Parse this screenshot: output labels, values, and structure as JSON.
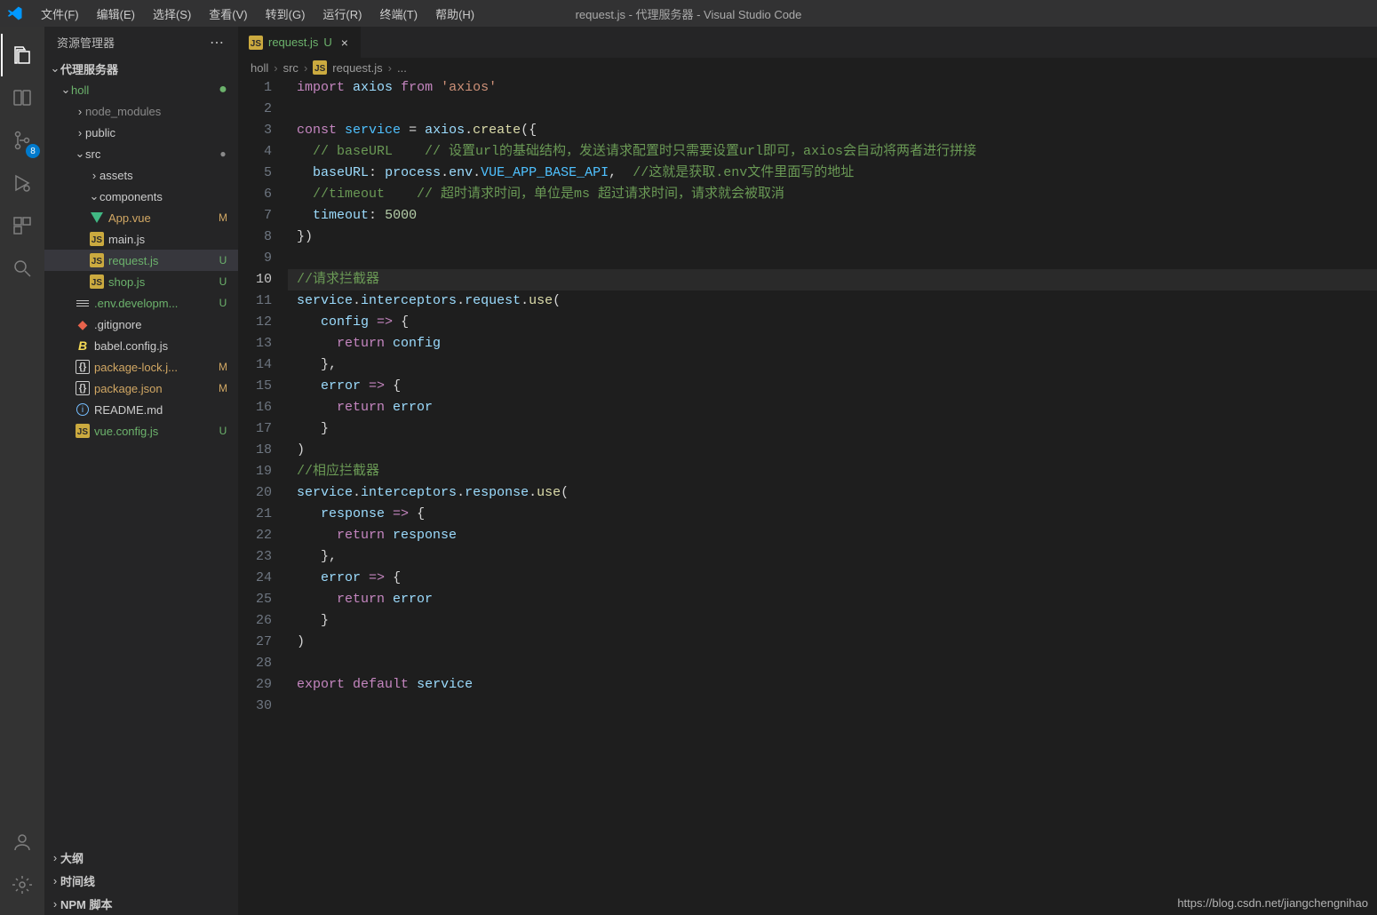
{
  "menu": [
    "文件(F)",
    "编辑(E)",
    "选择(S)",
    "查看(V)",
    "转到(G)",
    "运行(R)",
    "终端(T)",
    "帮助(H)"
  ],
  "window_title": "request.js - 代理服务器 - Visual Studio Code",
  "sidebar_title": "资源管理器",
  "scm_badge": "8",
  "project": {
    "name": "代理服务器",
    "root": "holl",
    "folders": {
      "node_modules": "node_modules",
      "public": "public",
      "src": "src",
      "assets": "assets",
      "components": "components"
    },
    "files": {
      "app_vue": {
        "label": "App.vue",
        "status": "M"
      },
      "main_js": {
        "label": "main.js",
        "status": ""
      },
      "request_js": {
        "label": "request.js",
        "status": "U"
      },
      "shop_js": {
        "label": "shop.js",
        "status": "U"
      },
      "env_dev": {
        "label": ".env.developm...",
        "status": "U"
      },
      "gitignore": {
        "label": ".gitignore",
        "status": ""
      },
      "babel": {
        "label": "babel.config.js",
        "status": ""
      },
      "pkg_lock": {
        "label": "package-lock.j...",
        "status": "M"
      },
      "pkg": {
        "label": "package.json",
        "status": "M"
      },
      "readme": {
        "label": "README.md",
        "status": ""
      },
      "vue_cfg": {
        "label": "vue.config.js",
        "status": "U"
      }
    }
  },
  "panels": {
    "outline": "大纲",
    "timeline": "时间线",
    "npm": "NPM 脚本"
  },
  "tab": {
    "name": "request.js",
    "status": "U"
  },
  "breadcrumb": {
    "p0": "holl",
    "p1": "src",
    "p2": "request.js",
    "p3": "..."
  },
  "code_tokens": [
    [
      [
        "kw",
        "import"
      ],
      [
        "punc",
        " "
      ],
      [
        "ident",
        "axios"
      ],
      [
        "punc",
        " "
      ],
      [
        "kw",
        "from"
      ],
      [
        "punc",
        " "
      ],
      [
        "str",
        "'axios'"
      ]
    ],
    [],
    [
      [
        "kw",
        "const"
      ],
      [
        "punc",
        " "
      ],
      [
        "const",
        "service"
      ],
      [
        "punc",
        " "
      ],
      [
        "punc",
        "="
      ],
      [
        "punc",
        " "
      ],
      [
        "ident",
        "axios"
      ],
      [
        "punc",
        "."
      ],
      [
        "fn",
        "create"
      ],
      [
        "punc",
        "("
      ],
      [
        "punc",
        "{"
      ]
    ],
    [
      [
        "punc",
        "  "
      ],
      [
        "com",
        "// baseURL    // 设置url的基础结构，发送请求配置时只需要设置url即可，axios会自动将两者进行拼接"
      ]
    ],
    [
      [
        "punc",
        "  "
      ],
      [
        "prop",
        "baseURL"
      ],
      [
        "punc",
        ":"
      ],
      [
        "punc",
        " "
      ],
      [
        "ident",
        "process"
      ],
      [
        "punc",
        "."
      ],
      [
        "ident",
        "env"
      ],
      [
        "punc",
        "."
      ],
      [
        "const",
        "VUE_APP_BASE_API"
      ],
      [
        "punc",
        ","
      ],
      [
        "punc",
        "  "
      ],
      [
        "com",
        "//这就是获取.env文件里面写的地址"
      ]
    ],
    [
      [
        "punc",
        "  "
      ],
      [
        "com",
        "//timeout    // 超时请求时间，单位是ms 超过请求时间，请求就会被取消"
      ]
    ],
    [
      [
        "punc",
        "  "
      ],
      [
        "prop",
        "timeout"
      ],
      [
        "punc",
        ":"
      ],
      [
        "punc",
        " "
      ],
      [
        "num",
        "5000"
      ]
    ],
    [
      [
        "punc",
        "}"
      ],
      [
        "punc",
        ")"
      ]
    ],
    [],
    [
      [
        "com",
        "//请求拦截器"
      ]
    ],
    [
      [
        "ident",
        "service"
      ],
      [
        "punc",
        "."
      ],
      [
        "ident",
        "interceptors"
      ],
      [
        "punc",
        "."
      ],
      [
        "ident",
        "request"
      ],
      [
        "punc",
        "."
      ],
      [
        "fn",
        "use"
      ],
      [
        "punc",
        "("
      ]
    ],
    [
      [
        "punc",
        "   "
      ],
      [
        "ident",
        "config"
      ],
      [
        "punc",
        " "
      ],
      [
        "kw",
        "=>"
      ],
      [
        "punc",
        " "
      ],
      [
        "punc",
        "{"
      ]
    ],
    [
      [
        "punc",
        "     "
      ],
      [
        "kw",
        "return"
      ],
      [
        "punc",
        " "
      ],
      [
        "ident",
        "config"
      ]
    ],
    [
      [
        "punc",
        "   "
      ],
      [
        "punc",
        "}"
      ],
      [
        "punc",
        ","
      ]
    ],
    [
      [
        "punc",
        "   "
      ],
      [
        "ident",
        "error"
      ],
      [
        "punc",
        " "
      ],
      [
        "kw",
        "=>"
      ],
      [
        "punc",
        " "
      ],
      [
        "punc",
        "{"
      ]
    ],
    [
      [
        "punc",
        "     "
      ],
      [
        "kw",
        "return"
      ],
      [
        "punc",
        " "
      ],
      [
        "ident",
        "error"
      ]
    ],
    [
      [
        "punc",
        "   "
      ],
      [
        "punc",
        "}"
      ]
    ],
    [
      [
        "punc",
        ")"
      ]
    ],
    [
      [
        "com",
        "//相应拦截器"
      ]
    ],
    [
      [
        "ident",
        "service"
      ],
      [
        "punc",
        "."
      ],
      [
        "ident",
        "interceptors"
      ],
      [
        "punc",
        "."
      ],
      [
        "ident",
        "response"
      ],
      [
        "punc",
        "."
      ],
      [
        "fn",
        "use"
      ],
      [
        "punc",
        "("
      ]
    ],
    [
      [
        "punc",
        "   "
      ],
      [
        "ident",
        "response"
      ],
      [
        "punc",
        " "
      ],
      [
        "kw",
        "=>"
      ],
      [
        "punc",
        " "
      ],
      [
        "punc",
        "{"
      ]
    ],
    [
      [
        "punc",
        "     "
      ],
      [
        "kw",
        "return"
      ],
      [
        "punc",
        " "
      ],
      [
        "ident",
        "response"
      ]
    ],
    [
      [
        "punc",
        "   "
      ],
      [
        "punc",
        "}"
      ],
      [
        "punc",
        ","
      ]
    ],
    [
      [
        "punc",
        "   "
      ],
      [
        "ident",
        "error"
      ],
      [
        "punc",
        " "
      ],
      [
        "kw",
        "=>"
      ],
      [
        "punc",
        " "
      ],
      [
        "punc",
        "{"
      ]
    ],
    [
      [
        "punc",
        "     "
      ],
      [
        "kw",
        "return"
      ],
      [
        "punc",
        " "
      ],
      [
        "ident",
        "error"
      ]
    ],
    [
      [
        "punc",
        "   "
      ],
      [
        "punc",
        "}"
      ]
    ],
    [
      [
        "punc",
        ")"
      ]
    ],
    [],
    [
      [
        "kw",
        "export"
      ],
      [
        "punc",
        " "
      ],
      [
        "kw",
        "default"
      ],
      [
        "punc",
        " "
      ],
      [
        "ident",
        "service"
      ]
    ],
    []
  ],
  "current_line": 10,
  "watermark": "https://blog.csdn.net/jiangchengnihao"
}
